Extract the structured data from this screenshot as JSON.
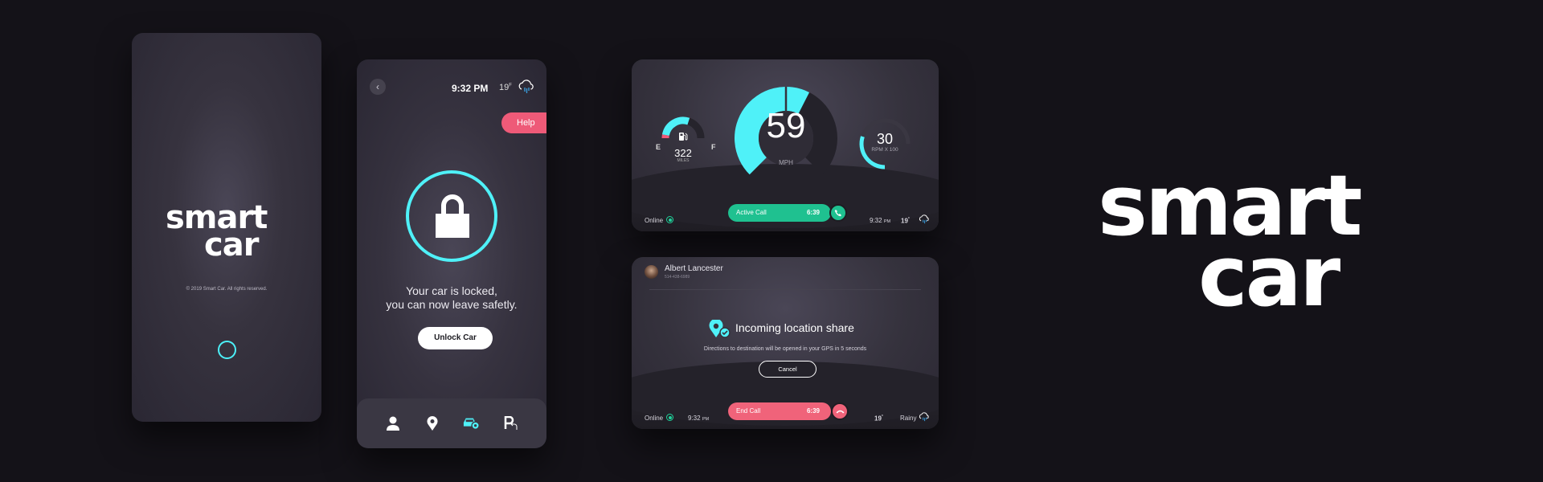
{
  "brand": {
    "line1": "smart",
    "line2": "car",
    "accent": "#4ff1f8",
    "alert": "#ee5a78",
    "success": "#1fc190"
  },
  "splash": {
    "copyright": "© 2019 Smart Car. All rights reserved.",
    "loader_icon": "loading-ring-icon"
  },
  "lock_screen": {
    "back_icon": "chevron-left-icon",
    "time": "9:32 PM",
    "temperature": "19",
    "temperature_unit": "F",
    "weather_icon": "rain-cloud-icon",
    "help_label": "Help",
    "lock_icon": "padlock-icon",
    "message_line1": "Your car is locked,",
    "message_line2": "you can now leave safetly.",
    "unlock_label": "Unlock Car",
    "tabs": [
      {
        "name": "profile",
        "icon": "person-icon",
        "active": false
      },
      {
        "name": "location",
        "icon": "map-pin-icon",
        "active": false
      },
      {
        "name": "car-settings",
        "icon": "car-gear-icon",
        "active": true
      },
      {
        "name": "parking",
        "icon": "parking-return-icon",
        "active": false
      }
    ]
  },
  "dashboard": {
    "fuel": {
      "label_empty": "E",
      "label_full": "F",
      "miles": "322",
      "miles_label": "MILES",
      "level": 0.6,
      "icon": "fuel-pump-icon"
    },
    "speed": {
      "value": "59",
      "unit": "MPH",
      "fraction": 0.6
    },
    "rpm": {
      "value": "30",
      "unit": "RPM X 100",
      "fraction": 0.4
    },
    "status": "Online",
    "call": {
      "label": "Active Call",
      "time": "6:39",
      "icon": "phone-icon"
    },
    "clock": "9:32",
    "clock_suffix": "PM",
    "temperature": "19",
    "temperature_unit": "°",
    "weather_icon": "rain-cloud-icon"
  },
  "incoming": {
    "caller_name": "Albert Lancester",
    "caller_phone": "514-438-6989",
    "title": "Incoming location share",
    "description": "Directions to destination will be opened in your GPS in 5 seconds",
    "cancel_label": "Cancel",
    "status": "Online",
    "clock": "9:32",
    "clock_suffix": "PM",
    "call": {
      "label": "End Call",
      "time": "6:39",
      "icon": "hang-up-icon"
    },
    "temperature": "19",
    "temperature_unit": "°",
    "weather_label": "Rainy",
    "weather_icon": "rain-cloud-icon"
  }
}
